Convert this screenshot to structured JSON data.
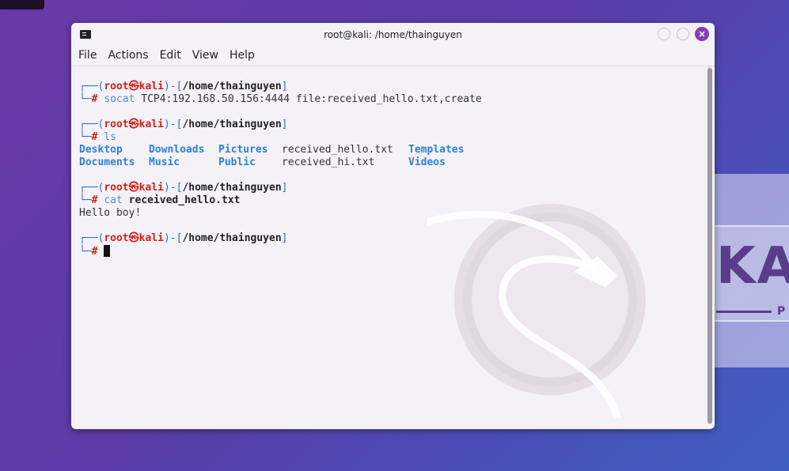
{
  "window": {
    "title": "root@kali: /home/thainguyen",
    "close_glyph": "×"
  },
  "menu": [
    "File",
    "Actions",
    "Edit",
    "View",
    "Help"
  ],
  "prompt": {
    "open": "┌──(",
    "user": "root",
    "skull": "㉿",
    "host": "kali",
    "mid": ")-[",
    "path": "/home/thainguyen",
    "close": "]",
    "line2": "└─",
    "hash": "#"
  },
  "commands": {
    "socat_cmd": "socat",
    "socat_args": "TCP4:192.168.50.156:4444 file:received_hello.txt,create",
    "ls_cmd": "ls",
    "cat_cmd": "cat",
    "cat_args": "received_hello.txt"
  },
  "ls_output": {
    "row1": [
      "Desktop",
      "Downloads",
      "Pictures",
      "received_hello.txt",
      "Templates"
    ],
    "row2": [
      "Documents",
      "Music",
      "Public",
      "received_hi.txt",
      "Videos"
    ]
  },
  "cat_output": "Hello boy!",
  "background": {
    "brand": "KA",
    "brand_sub": "P"
  },
  "colors": {
    "prompt_red": "#d0201a",
    "prompt_box": "#2f6fcf",
    "dir_blue": "#2f7fd8",
    "close_button": "#8a3bb8"
  }
}
